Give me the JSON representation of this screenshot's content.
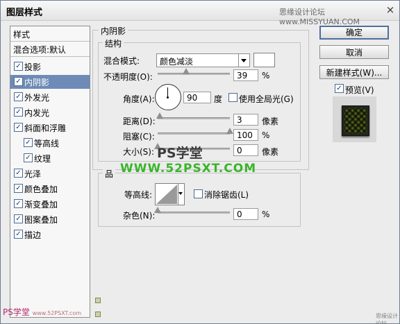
{
  "window": {
    "title": "图层样式",
    "close": "×"
  },
  "watermark": {
    "site": "思缘设计论坛",
    "url": "www.MISSYUAN.COM"
  },
  "left_panel": {
    "header": "样式",
    "blend_options": "混合选项:默认",
    "items": [
      {
        "label": "投影",
        "checked": true
      },
      {
        "label": "内阴影",
        "checked": true,
        "selected": true
      },
      {
        "label": "外发光",
        "checked": true
      },
      {
        "label": "内发光",
        "checked": true
      },
      {
        "label": "斜面和浮雕",
        "checked": true
      },
      {
        "label": "等高线",
        "checked": true,
        "sub": true
      },
      {
        "label": "纹理",
        "checked": true,
        "sub": true
      },
      {
        "label": "光泽",
        "checked": true
      },
      {
        "label": "颜色叠加",
        "checked": true
      },
      {
        "label": "渐变叠加",
        "checked": true
      },
      {
        "label": "图案叠加",
        "checked": true
      },
      {
        "label": "描边",
        "checked": true
      }
    ]
  },
  "inner_shadow": {
    "title": "内阴影",
    "structure": {
      "title": "结构",
      "blend_mode_label": "混合模式:",
      "blend_mode_value": "颜色减淡",
      "opacity_label": "不透明度(O):",
      "opacity_value": "39",
      "opacity_unit": "%",
      "angle_label": "角度(A):",
      "angle_value": "90",
      "angle_unit": "度",
      "global_light_label": "使用全局光(G)",
      "global_light_checked": false,
      "distance_label": "距离(D):",
      "distance_value": "3",
      "distance_unit": "像素",
      "choke_label": "阻塞(C):",
      "choke_value": "100",
      "choke_unit": "%",
      "size_label": "大小(S):",
      "size_value": "0",
      "size_unit": "像素"
    },
    "quality": {
      "title": "品",
      "contour_label": "等高线:",
      "anti_alias_label": "消除锯齿(L)",
      "anti_alias_checked": false,
      "noise_label": "杂色(N):",
      "noise_value": "0",
      "noise_unit": "%"
    }
  },
  "buttons": {
    "ok": "确定",
    "cancel": "取消",
    "new_style": "新建样式(W)...",
    "preview_label": "预览(V)",
    "preview_checked": true
  },
  "overlay": {
    "brand": "PS学堂",
    "url": "WWW.52PSXT.COM",
    "bottom_brand": "PS学堂",
    "bottom_url": "www.52PSXT.com",
    "bottom_right": "思缘设计论坛"
  },
  "sliders": {
    "opacity": 0.39,
    "distance": 0.03,
    "choke": 1.0,
    "size": 0.0,
    "noise": 0.0
  }
}
